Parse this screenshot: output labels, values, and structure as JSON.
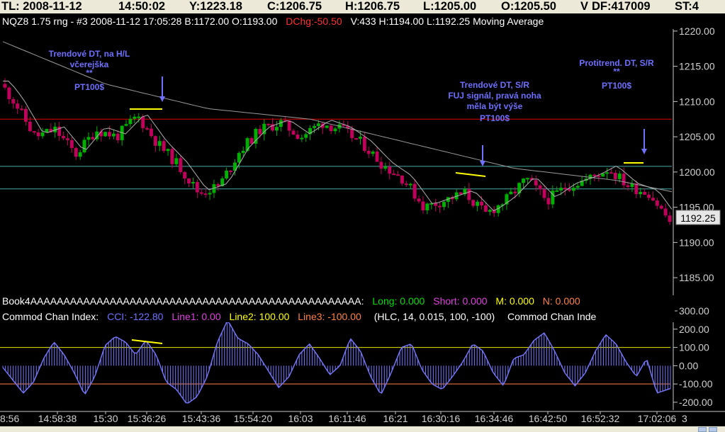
{
  "topbar": {
    "items": [
      "TL: 2008-11-12",
      "14:50:02",
      "Y:1223.18",
      "C:1206.75",
      "H:1206.75",
      "L:1205.00",
      "O:1205.50",
      "V",
      "DF:417009",
      "ST:4"
    ]
  },
  "price_panel": {
    "header": [
      {
        "text": "NQZ8  1.75 rng - #3  2008-11-12  17:05:28  B:1172.00  O:1193.00",
        "color": "#ffffff"
      },
      {
        "text": "DChg:-50.50",
        "color": "#ff3030"
      },
      {
        "text": "V:433  H:1194.00  L:1192.25   Moving Average",
        "color": "#ffffff"
      }
    ],
    "last_price": "1192.25"
  },
  "book_line": [
    {
      "text": "Book4AAAAAAAAAAAAAAAAAAAAAAAAAAAAAAAAAAAAAAAAAAAAAAAAAA:",
      "color": "#ffffff"
    },
    {
      "text": "Long: 0.000",
      "color": "#00e000"
    },
    {
      "text": "Short: 0.000",
      "color": "#e040e0"
    },
    {
      "text": "M: 0.000",
      "color": "#ffff00"
    },
    {
      "text": "N: 0.000",
      "color": "#ff8040"
    }
  ],
  "cci_line": [
    {
      "text": "Commod Chan Index:",
      "color": "#ffffff"
    },
    {
      "text": "CCI: -122.80",
      "color": "#7070ff"
    },
    {
      "text": "Line1: 0.00",
      "color": "#e040e0"
    },
    {
      "text": "Line2: 100.00",
      "color": "#ffff00"
    },
    {
      "text": "Line3: -100.00",
      "color": "#ff8040"
    },
    {
      "text": "(HLC, 14, 0.015, 100, -100)",
      "color": "#ffffff"
    },
    {
      "text": "Commod Chan Inde",
      "color": "#ffffff"
    }
  ],
  "annotations": [
    {
      "lines": [
        "Trendové DT, na H/L",
        "včerejška",
        "**",
        "PT100$"
      ]
    },
    {
      "lines": [
        "Trendové DT, S/R",
        "FUJ signál, pravá noha",
        "měla být výše",
        "PT100$"
      ]
    },
    {
      "lines": [
        "Protitrend. DT, S/R",
        "**",
        "PT100$"
      ]
    }
  ],
  "colors": {
    "up": "#00b000",
    "down": "#c0005a",
    "ma": "#9a9a9a",
    "cci": "#7878ff",
    "resistance": "#e00000",
    "support": "#4aa8a8",
    "marker": "#ffff00",
    "arrow": "#7070ff"
  },
  "chart_data": [
    {
      "type": "candlestick",
      "title": "",
      "y_ticks": [
        1185.0,
        1190.0,
        1195.0,
        1200.0,
        1205.0,
        1210.0,
        1215.0,
        1220.0
      ],
      "y_tick_labels": [
        "1185.00",
        "1190.00",
        "1195.00",
        "1200.00",
        "1205.00",
        "1210.00",
        "1215.00",
        "1220.00"
      ],
      "ylim": [
        1182.5,
        1222.5
      ],
      "x_tick_labels": [
        "14:58:38",
        "15:30",
        "15:36:26",
        "15:43:36",
        "15:54:20",
        "16:03",
        "16:11:46",
        "16:21",
        "16:30:16",
        "16:34:46",
        "16:42:50",
        "16:52:32",
        "17:02:06"
      ],
      "x_tick_label_partial_left": "8:56",
      "x_tick_label_partial_right": "3",
      "bars_count": 160,
      "close_path": [
        [
          0,
          1212.5
        ],
        [
          4,
          1210
        ],
        [
          10,
          1205
        ],
        [
          16,
          1206
        ],
        [
          22,
          1202.5
        ],
        [
          28,
          1206
        ],
        [
          34,
          1205
        ],
        [
          40,
          1208
        ],
        [
          46,
          1204
        ],
        [
          52,
          1201
        ],
        [
          58,
          1197
        ],
        [
          64,
          1198
        ],
        [
          70,
          1203
        ],
        [
          76,
          1206
        ],
        [
          82,
          1207
        ],
        [
          88,
          1205
        ],
        [
          94,
          1207
        ],
        [
          100,
          1206
        ],
        [
          106,
          1204
        ],
        [
          112,
          1201
        ],
        [
          118,
          1199
        ],
        [
          124,
          1195
        ],
        [
          130,
          1196
        ],
        [
          136,
          1197
        ],
        [
          142,
          1194
        ],
        [
          148,
          1196
        ],
        [
          154,
          1199
        ],
        [
          160,
          1196
        ],
        [
          166,
          1198
        ],
        [
          172,
          1199
        ],
        [
          178,
          1200.5
        ],
        [
          184,
          1198
        ],
        [
          190,
          1197
        ],
        [
          196,
          1193
        ]
      ],
      "close_path_x_range": [
        0,
        196
      ],
      "levels": {
        "resistance": 1207.5,
        "support_upper": 1200.8,
        "support_lower": 1197.6
      },
      "last_value": 1192.25,
      "moving_average_path": [
        [
          0,
          1218.5
        ],
        [
          30,
          1212.5
        ],
        [
          60,
          1209
        ],
        [
          90,
          1207.5
        ],
        [
          120,
          1204
        ],
        [
          150,
          1200.5
        ],
        [
          180,
          1198.8
        ],
        [
          196,
          1197.2
        ]
      ]
    },
    {
      "type": "bar",
      "title": "Commod Chan Index",
      "y_ticks": [
        -200,
        -100,
        0,
        100,
        200,
        300
      ],
      "y_tick_labels": [
        "-200.00",
        "-100.00",
        "0.00",
        "100.00",
        "200.00",
        "300.00"
      ],
      "ylim": [
        -235,
        300
      ],
      "reference_lines": [
        100,
        -100
      ],
      "last_value": -122.8,
      "cci_path": [
        [
          0,
          -10
        ],
        [
          3,
          -80
        ],
        [
          6,
          -150
        ],
        [
          9,
          -90
        ],
        [
          12,
          40
        ],
        [
          15,
          130
        ],
        [
          18,
          60
        ],
        [
          21,
          -40
        ],
        [
          24,
          -160
        ],
        [
          27,
          -60
        ],
        [
          30,
          110
        ],
        [
          33,
          160
        ],
        [
          36,
          130
        ],
        [
          39,
          60
        ],
        [
          42,
          140
        ],
        [
          45,
          60
        ],
        [
          48,
          -90
        ],
        [
          51,
          -130
        ],
        [
          54,
          -210
        ],
        [
          57,
          -170
        ],
        [
          60,
          -60
        ],
        [
          63,
          130
        ],
        [
          66,
          250
        ],
        [
          69,
          150
        ],
        [
          72,
          120
        ],
        [
          75,
          60
        ],
        [
          78,
          -30
        ],
        [
          81,
          -120
        ],
        [
          84,
          -60
        ],
        [
          87,
          60
        ],
        [
          90,
          120
        ],
        [
          93,
          40
        ],
        [
          96,
          -50
        ],
        [
          99,
          0
        ],
        [
          102,
          150
        ],
        [
          105,
          80
        ],
        [
          108,
          -60
        ],
        [
          111,
          -160
        ],
        [
          114,
          -40
        ],
        [
          117,
          100
        ],
        [
          120,
          120
        ],
        [
          123,
          -20
        ],
        [
          126,
          -100
        ],
        [
          129,
          -130
        ],
        [
          132,
          -60
        ],
        [
          135,
          20
        ],
        [
          138,
          120
        ],
        [
          141,
          80
        ],
        [
          144,
          -40
        ],
        [
          147,
          -110
        ],
        [
          150,
          40
        ],
        [
          153,
          60
        ],
        [
          156,
          140
        ],
        [
          159,
          180
        ],
        [
          162,
          80
        ],
        [
          165,
          -40
        ],
        [
          168,
          -110
        ],
        [
          171,
          -40
        ],
        [
          174,
          80
        ],
        [
          177,
          170
        ],
        [
          180,
          120
        ],
        [
          183,
          20
        ],
        [
          186,
          -60
        ],
        [
          189,
          40
        ],
        [
          192,
          -150
        ],
        [
          196,
          -125
        ]
      ],
      "cci_path_x_range": [
        0,
        196
      ]
    }
  ]
}
